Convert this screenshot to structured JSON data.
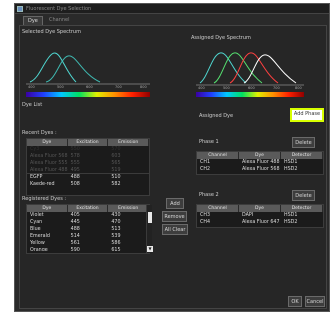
{
  "window": {
    "title": "Fluorescent Dye Selection"
  },
  "tabs": [
    {
      "label": "Dye"
    },
    {
      "label": "Channel"
    }
  ],
  "left": {
    "selected_spectrum_label": "Selected Dye Spectrum",
    "axis_ticks": [
      "400",
      "500",
      "600",
      "700",
      "800"
    ],
    "dye_list_label": "Dye List",
    "recent_dyes_label": "Recent Dyes :",
    "recent_table": {
      "headers": [
        "Dye",
        "Excitation",
        "Emission"
      ],
      "faded_rows": [
        {
          "dye": "Cy3",
          "ex": "550",
          "em": "570"
        },
        {
          "dye": "Alexa Fluor 568",
          "ex": "578",
          "em": "603"
        },
        {
          "dye": "Alexa Fluor 555",
          "ex": "555",
          "em": "565"
        },
        {
          "dye": "Alexa Fluor 488",
          "ex": "495",
          "em": "519"
        }
      ],
      "rows": [
        {
          "dye": "EGFP",
          "ex": "488",
          "em": "510"
        },
        {
          "dye": "Kaede-red",
          "ex": "508",
          "em": "582"
        }
      ]
    },
    "registered_dyes_label": "Registered Dyes :",
    "registered_table": {
      "headers": [
        "Dye",
        "Excitation",
        "Emission"
      ],
      "rows": [
        {
          "dye": "Violet",
          "ex": "405",
          "em": "430"
        },
        {
          "dye": "Cyan",
          "ex": "445",
          "em": "470"
        },
        {
          "dye": "Blue",
          "ex": "488",
          "em": "513"
        },
        {
          "dye": "Emerald",
          "ex": "514",
          "em": "539"
        },
        {
          "dye": "Yellow",
          "ex": "561",
          "em": "586"
        },
        {
          "dye": "Orange",
          "ex": "590",
          "em": "615"
        }
      ]
    }
  },
  "middle": {
    "add_label": "Add",
    "remove_label": "Remove",
    "all_clear_label": "All Clear"
  },
  "right": {
    "assigned_spectrum_label": "Assigned Dye Spectrum",
    "axis_ticks": [
      "400",
      "500",
      "600",
      "700",
      "800"
    ],
    "assigned_dye_label": "Assigned Dye",
    "add_phase_label": "Add Phase",
    "phase1": {
      "label": "Phase 1",
      "delete_label": "Delete",
      "headers": [
        "Channel",
        "Dye",
        "Detector"
      ],
      "rows": [
        {
          "channel": "CH1",
          "dye": "Alexa Fluor 488",
          "detector": "HSD1"
        },
        {
          "channel": "CH2",
          "dye": "Alexa Fluor 568",
          "detector": "HSD2"
        }
      ]
    },
    "phase2": {
      "label": "Phase 2",
      "delete_label": "Delete",
      "headers": [
        "Channel",
        "Dye",
        "Detector"
      ],
      "rows": [
        {
          "channel": "CH3",
          "dye": "DAPI",
          "detector": "HSD1"
        },
        {
          "channel": "CH4",
          "dye": "Alexa Fluor 647",
          "detector": "HSD2"
        }
      ]
    }
  },
  "footer": {
    "ok_label": "OK",
    "cancel_label": "Cancel"
  },
  "colors": {
    "highlight_border": "#d8ff00",
    "curve_cyan": "#4fd6d0",
    "curve_green": "#55e070",
    "curve_red": "#ff4040",
    "curve_white": "#ffffff"
  }
}
